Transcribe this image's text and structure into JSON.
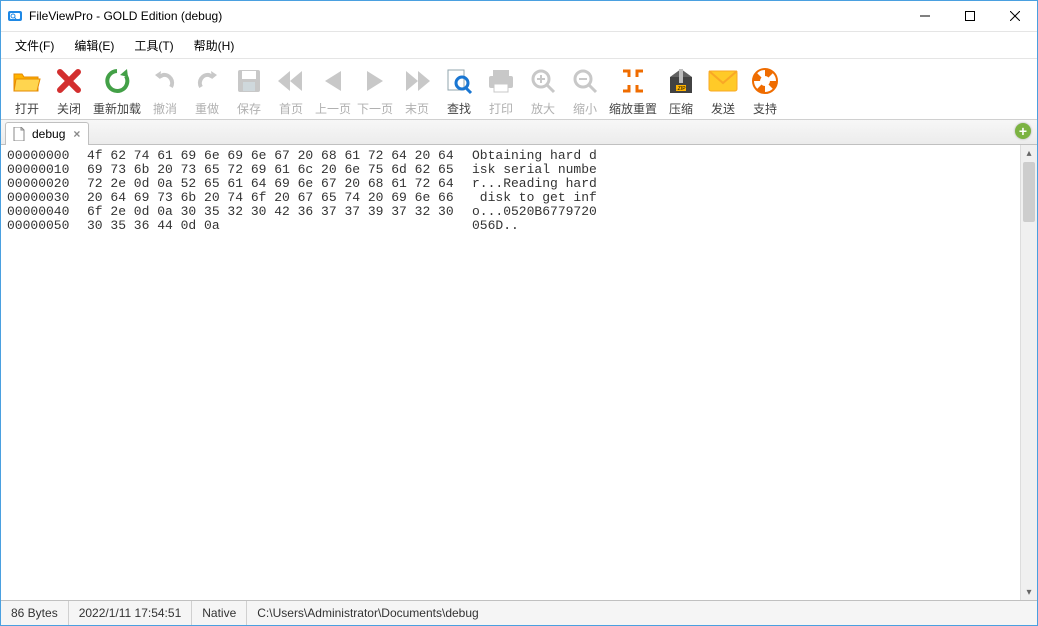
{
  "window": {
    "title": "FileViewPro - GOLD Edition (debug)"
  },
  "menu": {
    "items": [
      "文件(F)",
      "编辑(E)",
      "工具(T)",
      "帮助(H)"
    ]
  },
  "toolbar": {
    "items": [
      {
        "id": "open",
        "label": "打开",
        "disabled": false
      },
      {
        "id": "close",
        "label": "关闭",
        "disabled": false
      },
      {
        "id": "reload",
        "label": "重新加载",
        "disabled": false
      },
      {
        "id": "undo",
        "label": "撤消",
        "disabled": true
      },
      {
        "id": "redo",
        "label": "重做",
        "disabled": true
      },
      {
        "id": "save",
        "label": "保存",
        "disabled": true
      },
      {
        "id": "first",
        "label": "首页",
        "disabled": true
      },
      {
        "id": "prev",
        "label": "上一页",
        "disabled": true
      },
      {
        "id": "next",
        "label": "下一页",
        "disabled": true
      },
      {
        "id": "last",
        "label": "末页",
        "disabled": true
      },
      {
        "id": "find",
        "label": "查找",
        "disabled": false
      },
      {
        "id": "print",
        "label": "打印",
        "disabled": true
      },
      {
        "id": "zoomin",
        "label": "放大",
        "disabled": true
      },
      {
        "id": "zoomout",
        "label": "缩小",
        "disabled": true
      },
      {
        "id": "zoomreset",
        "label": "缩放重置",
        "disabled": false
      },
      {
        "id": "zip",
        "label": "压缩",
        "disabled": false
      },
      {
        "id": "send",
        "label": "发送",
        "disabled": false
      },
      {
        "id": "support",
        "label": "支持",
        "disabled": false
      }
    ]
  },
  "tabs": {
    "active": {
      "name": "debug"
    }
  },
  "hex": {
    "rows": [
      {
        "off": "00000000",
        "hex": "4f 62 74 61 69 6e 69 6e 67 20 68 61 72 64 20 64",
        "asc": "Obtaining hard d"
      },
      {
        "off": "00000010",
        "hex": "69 73 6b 20 73 65 72 69 61 6c 20 6e 75 6d 62 65",
        "asc": "isk serial numbe"
      },
      {
        "off": "00000020",
        "hex": "72 2e 0d 0a 52 65 61 64 69 6e 67 20 68 61 72 64",
        "asc": "r...Reading hard"
      },
      {
        "off": "00000030",
        "hex": "20 64 69 73 6b 20 74 6f 20 67 65 74 20 69 6e 66",
        "asc": " disk to get inf"
      },
      {
        "off": "00000040",
        "hex": "6f 2e 0d 0a 30 35 32 30 42 36 37 37 39 37 32 30",
        "asc": "o...0520B6779720"
      },
      {
        "off": "00000050",
        "hex": "30 35 36 44 0d 0a",
        "asc": "056D.."
      }
    ]
  },
  "status": {
    "size": "86 Bytes",
    "time": "2022/1/11 17:54:51",
    "mode": "Native",
    "path": "C:\\Users\\Administrator\\Documents\\debug"
  }
}
